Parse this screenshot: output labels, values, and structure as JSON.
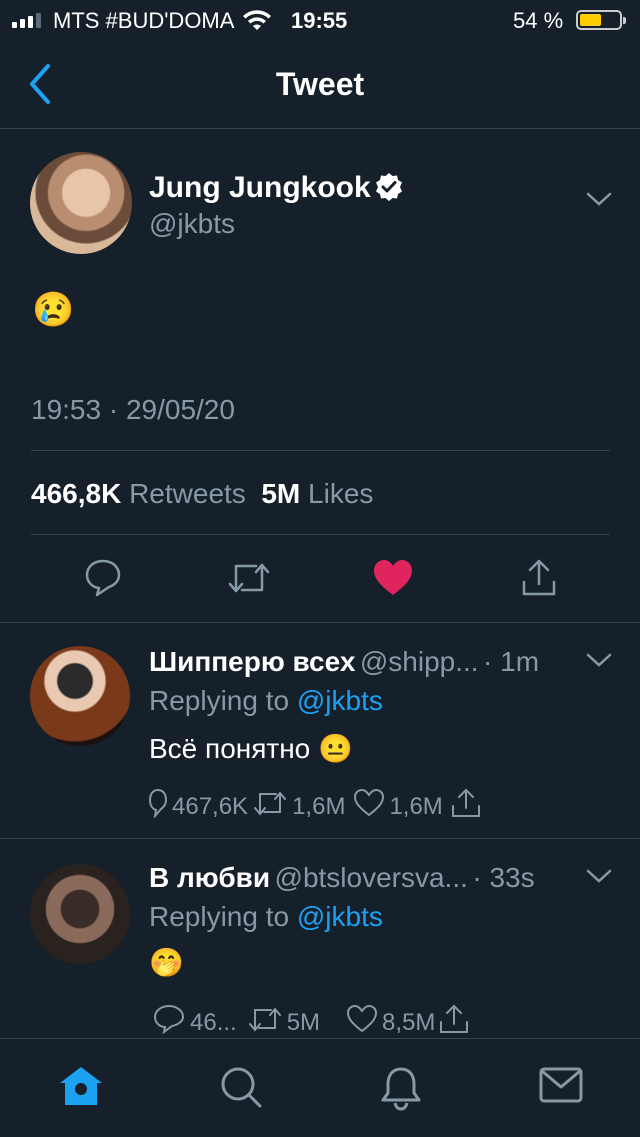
{
  "status_bar": {
    "carrier": "MTS #BUD'DOMA",
    "time": "19:55",
    "battery": "54 %",
    "battery_level": 0.54
  },
  "nav": {
    "title": "Tweet"
  },
  "tweet": {
    "author_name": "Jung Jungkook",
    "author_handle": "@jkbts",
    "text": "😢",
    "timestamp": "19:53 · 29/05/20",
    "retweets_count": "466,8K",
    "retweets_label": "Retweets",
    "likes_count": "5M",
    "likes_label": "Likes"
  },
  "replies": [
    {
      "name": "Шипперю всех",
      "handle": "@shipp...",
      "time": "· 1m",
      "replying_prefix": "Replying to",
      "replying_to": "@jkbts",
      "text": "Всё понятно 😐",
      "replies": "467,6K",
      "retweets": "1,6M",
      "likes": "1,6M"
    },
    {
      "name": "В любви",
      "handle": "@btsloversva...",
      "time": "· 33s",
      "replying_prefix": "Replying to",
      "replying_to": "@jkbts",
      "text": "🤭",
      "replies": "46...",
      "retweets": "5M",
      "likes": "8,5M"
    }
  ],
  "colors": {
    "background": "#15202b",
    "accent": "#1da1f2",
    "like": "#e0245e",
    "muted": "#8899a6"
  },
  "icons": [
    "back-chevron-icon",
    "verified-badge-icon",
    "chevron-down-icon",
    "reply-icon",
    "retweet-icon",
    "heart-icon",
    "share-icon",
    "home-icon",
    "search-icon",
    "bell-icon",
    "mail-icon"
  ]
}
